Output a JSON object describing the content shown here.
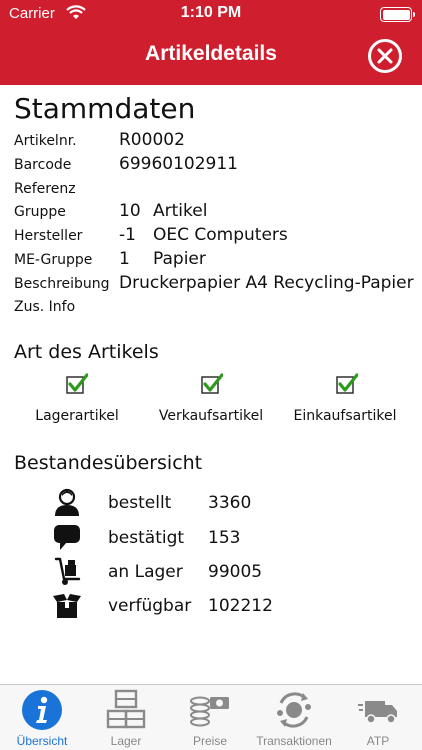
{
  "status": {
    "carrier": "Carrier",
    "time": "1:10 PM"
  },
  "nav": {
    "title": "Artikeldetails"
  },
  "stammdaten": {
    "heading": "Stammdaten",
    "rows": [
      {
        "label": "Artikelnr.",
        "v1": "R00002",
        "v2": ""
      },
      {
        "label": "Barcode",
        "v1": "69960102911",
        "v2": ""
      },
      {
        "label": "Referenz",
        "v1": "",
        "v2": ""
      },
      {
        "label": "Gruppe",
        "v1": "10",
        "v2": "Artikel"
      },
      {
        "label": "Hersteller",
        "v1": "-1",
        "v2": "OEC Computers"
      },
      {
        "label": "ME-Gruppe",
        "v1": "1",
        "v2": "Papier"
      },
      {
        "label": "Beschreibung",
        "v1": "Druckerpapier A4 Recycling-Papier",
        "v2": ""
      },
      {
        "label": "Zus. Info",
        "v1": "",
        "v2": ""
      }
    ]
  },
  "art": {
    "heading": "Art des Artikels",
    "items": [
      {
        "label": "Lagerartikel",
        "checked": true
      },
      {
        "label": "Verkaufsartikel",
        "checked": true
      },
      {
        "label": "Einkaufsartikel",
        "checked": true
      }
    ]
  },
  "bestand": {
    "heading": "Bestandesübersicht",
    "rows": [
      {
        "icon": "person-icon",
        "label": "bestellt",
        "value": "3360"
      },
      {
        "icon": "speech-bubble-icon",
        "label": "bestätigt",
        "value": "153"
      },
      {
        "icon": "hand-truck-icon",
        "label": "an Lager",
        "value": "99005"
      },
      {
        "icon": "open-box-icon",
        "label": "verfügbar",
        "value": "102212"
      }
    ]
  },
  "tabs": [
    {
      "icon": "info-icon",
      "label": "Übersicht",
      "active": true
    },
    {
      "icon": "warehouse-boxes-icon",
      "label": "Lager",
      "active": false
    },
    {
      "icon": "coins-money-icon",
      "label": "Preise",
      "active": false
    },
    {
      "icon": "transactions-cycle-icon",
      "label": "Transaktionen",
      "active": false
    },
    {
      "icon": "delivery-truck-icon",
      "label": "ATP",
      "active": false
    }
  ],
  "colors": {
    "accent": "#cf1f2e",
    "tab_active": "#1a73d9",
    "tab_inactive": "#8a8a8a",
    "check": "#2e9a1c"
  }
}
